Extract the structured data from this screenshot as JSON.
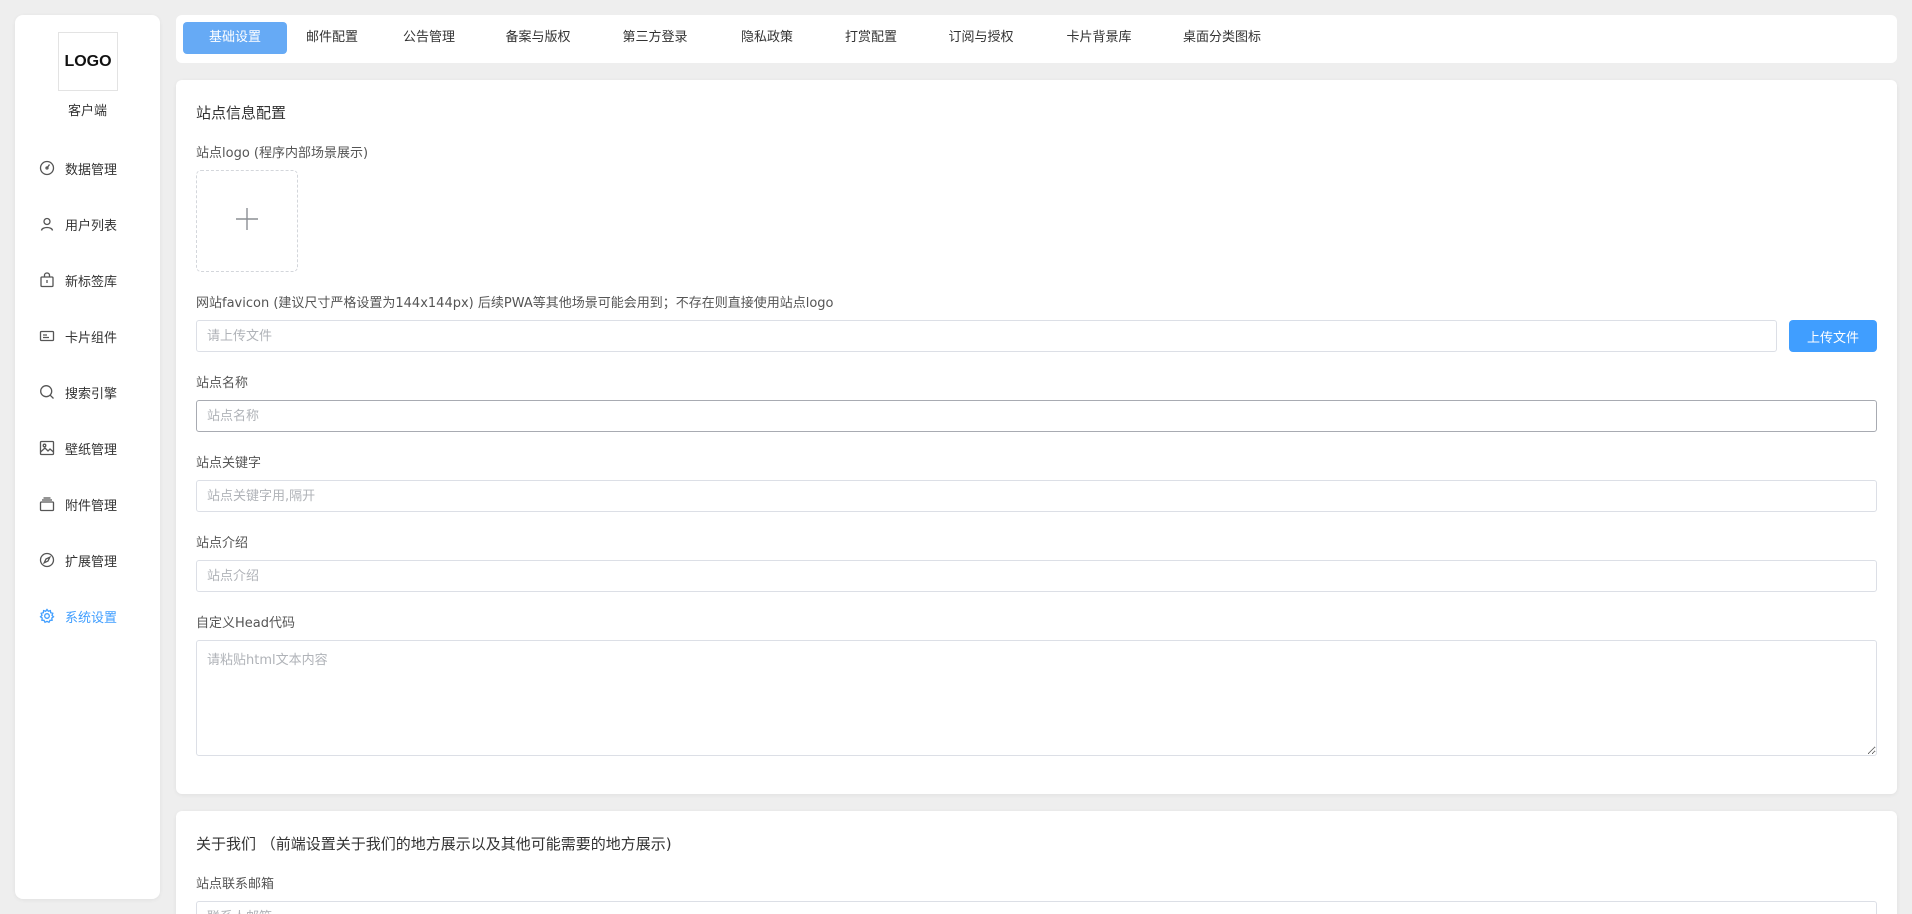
{
  "sidebar": {
    "logo": "LOGO",
    "client_label": "客户端",
    "items": [
      {
        "label": "数据管理",
        "icon": "dashboard-icon"
      },
      {
        "label": "用户列表",
        "icon": "user-icon"
      },
      {
        "label": "新标签库",
        "icon": "bag-icon"
      },
      {
        "label": "卡片组件",
        "icon": "card-icon"
      },
      {
        "label": "搜索引擎",
        "icon": "search-icon"
      },
      {
        "label": "壁纸管理",
        "icon": "picture-icon"
      },
      {
        "label": "附件管理",
        "icon": "files-icon"
      },
      {
        "label": "扩展管理",
        "icon": "compass-icon"
      },
      {
        "label": "系统设置",
        "icon": "gear-icon",
        "active": true
      }
    ]
  },
  "tabs": [
    {
      "label": "基础设置",
      "active": true
    },
    {
      "label": "邮件配置"
    },
    {
      "label": "公告管理"
    },
    {
      "label": "备案与版权"
    },
    {
      "label": "第三方登录"
    },
    {
      "label": "隐私政策"
    },
    {
      "label": "打赏配置"
    },
    {
      "label": "订阅与授权"
    },
    {
      "label": "卡片背景库"
    },
    {
      "label": "桌面分类图标"
    }
  ],
  "site_info": {
    "title": "站点信息配置",
    "logo_label": "站点logo (程序内部场景展示)",
    "favicon_label": "网站favicon (建议尺寸严格设置为144x144px) 后续PWA等其他场景可能会用到；不存在则直接使用站点logo",
    "favicon_placeholder": "请上传文件",
    "upload_button": "上传文件",
    "name_label": "站点名称",
    "name_placeholder": "站点名称",
    "keywords_label": "站点关键字",
    "keywords_placeholder": "站点关键字用,隔开",
    "intro_label": "站点介绍",
    "intro_placeholder": "站点介绍",
    "head_label": "自定义Head代码",
    "head_placeholder": "请粘贴html文本内容"
  },
  "about": {
    "title": "关于我们 （前端设置关于我们的地方展示以及其他可能需要的地方展示)",
    "email_label": "站点联系邮箱",
    "email_placeholder": "联系人邮箱"
  },
  "colors": {
    "accent": "#409eff",
    "active_tab_bg": "#66aaf5",
    "page_bg": "#eeeeee"
  }
}
